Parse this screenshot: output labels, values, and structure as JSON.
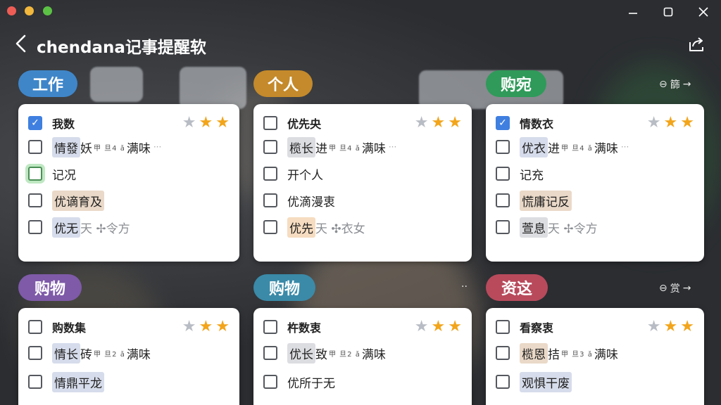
{
  "window": {
    "title": "chendana记事提醒软",
    "min_icon": "minimize-icon",
    "max_icon": "maximize-icon",
    "close_icon": "close-icon"
  },
  "colors": {
    "tag_blue": "#3f86c9",
    "tag_gold": "#c48a2b",
    "tag_green": "#2f9a5a",
    "tag_purple": "#7e5aa8",
    "tag_teal": "#3a8aa8",
    "tag_red": "#b84a5c",
    "star_on": "#f2a51b",
    "check_blue": "#3f7fe0"
  },
  "categories": [
    {
      "tag": "工作",
      "items": [
        {
          "text": "我数",
          "checked": true
        },
        {
          "text": "情發",
          "extra": "妖",
          "sup": "甲 旦4 ǎ",
          "tail": "满味",
          "dots": "···"
        },
        {
          "text": "记况",
          "highlight": true
        },
        {
          "text": "优谪育及"
        },
        {
          "text": "优无",
          "extra": "天 ✢令方"
        }
      ]
    },
    {
      "tag": "个人",
      "items": [
        {
          "text": "优先央",
          "checked": false
        },
        {
          "text": "榄长",
          "extra": "进",
          "sup": "甲 旦4 ǎ",
          "tail": "满味",
          "dots": "···"
        },
        {
          "text": "开个人"
        },
        {
          "text": "优滴漫衷"
        },
        {
          "text": "优先",
          "extra": "天 ✣衣女"
        }
      ]
    },
    {
      "tag": "购宛",
      "side": "篩",
      "items": [
        {
          "text": "情数衣",
          "checked": true
        },
        {
          "text": "优衣",
          "extra": "进",
          "sup": "甲 旦4 ǎ",
          "tail": "满味",
          "dots": "···"
        },
        {
          "text": "记充"
        },
        {
          "text": "慌庸记反"
        },
        {
          "text": "萱息",
          "extra": "天 ✢令方"
        }
      ]
    },
    {
      "tag": "购物",
      "items": [
        {
          "text": "购数集",
          "checked": false
        },
        {
          "text": "情长",
          "extra": "砖",
          "sup": "甲 旦2 ǎ",
          "tail": "满味"
        },
        {
          "text": "情鼎平龙"
        }
      ]
    },
    {
      "tag": "购物",
      "side": "··",
      "items": [
        {
          "text": "杵数衷",
          "checked": false
        },
        {
          "text": "优长",
          "extra": "致",
          "sup": "甲 旦2 ǎ",
          "tail": "满味"
        },
        {
          "text": "优所于无"
        }
      ]
    },
    {
      "tag": "资这",
      "side": "赏",
      "items": [
        {
          "text": "看察衷",
          "checked": false
        },
        {
          "text": "榄恩",
          "extra": "拮",
          "sup": "甲 旦3 ǎ",
          "tail": "满味"
        },
        {
          "text": "观惧干废"
        }
      ]
    }
  ]
}
